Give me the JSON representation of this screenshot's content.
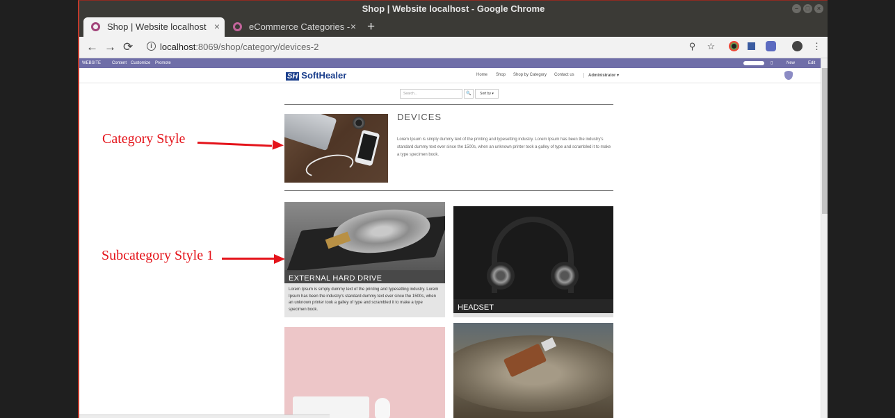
{
  "window": {
    "title": "Shop | Website localhost - Google Chrome",
    "controls": {
      "minimize": "–",
      "maximize": "□",
      "close": "×"
    }
  },
  "tabs": [
    {
      "label": "Shop | Website localhost",
      "close": "×"
    },
    {
      "label": "eCommerce Categories - ",
      "close": "×"
    }
  ],
  "new_tab": "+",
  "toolbar": {
    "back": "←",
    "forward": "→",
    "reload": "⟳",
    "info": "i",
    "url_host": "localhost",
    "url_path": ":8069/shop/category/devices-2",
    "zoom": "⚲",
    "star": "☆",
    "menu": "⋮"
  },
  "odoo_bar": {
    "website": "WEBSITE",
    "content": "Content",
    "customize": "Customize",
    "promote": "Promote",
    "new": "New",
    "edit": "Edit"
  },
  "site_nav": {
    "logo_mark": "SH",
    "logo_text": "SoftHealer",
    "links": [
      "Home",
      "Shop",
      "Shop by Category",
      "Contact us"
    ],
    "user": "Administrator ▾"
  },
  "search": {
    "placeholder": "Search...",
    "button_icon": "🔍",
    "sort": "Sort by ▾"
  },
  "category": {
    "title": "DEVICES",
    "description": "Lorem Ipsum is simply dummy text of the printing and typesetting industry. Lorem Ipsum has been the industry's standard dummy text ever since the 1500s, when an unknown printer took a galley of type and scrambled it to make a type specimen book."
  },
  "subcategories": [
    {
      "title": "EXTERNAL HARD DRIVE",
      "description": "Lorem Ipsum is simply dummy text of the printing and typesetting industry. Lorem Ipsum has been the industry's standard dummy text ever since the 1500s, when an unknown printer took a galley of type and scrambled it to make a type specimen book."
    },
    {
      "title": "HEADSET"
    }
  ],
  "annotations": {
    "category_style": "Category Style",
    "subcategory_style": "Subcategory Style 1"
  },
  "colors": {
    "annotation_red": "#e4131a",
    "odoo_bar": "#6f6ea8",
    "chrome_dark": "#3b3a36"
  }
}
